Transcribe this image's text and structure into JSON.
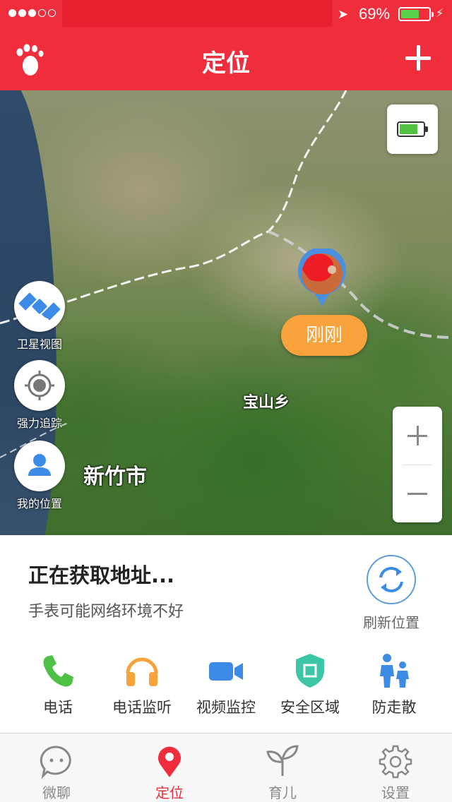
{
  "status_bar": {
    "battery_percent": "69%"
  },
  "nav": {
    "title": "定位"
  },
  "map": {
    "place_labels": {
      "town": "宝山乡",
      "city": "新竹市"
    },
    "side_buttons": [
      {
        "label": "卫星视图",
        "icon": "satellite-icon"
      },
      {
        "label": "强力追踪",
        "icon": "target-icon"
      },
      {
        "label": "我的位置",
        "icon": "person-icon"
      }
    ],
    "marker_time": "刚刚"
  },
  "location": {
    "address": "正在获取地址...",
    "note": "手表可能网络环境不好",
    "refresh_label": "刷新位置"
  },
  "functions": [
    {
      "label": "电话",
      "icon": "phone-icon",
      "color": "#4cc146"
    },
    {
      "label": "电话监听",
      "icon": "headphones-icon",
      "color": "#f7a23a"
    },
    {
      "label": "视频监控",
      "icon": "video-camera-icon",
      "color": "#3c8ce7"
    },
    {
      "label": "安全区域",
      "icon": "shield-icon",
      "color": "#3cc6a6"
    },
    {
      "label": "防走散",
      "icon": "family-icon",
      "color": "#3c8ce7"
    }
  ],
  "tabs": [
    {
      "label": "微聊",
      "icon": "chat-icon",
      "active": false
    },
    {
      "label": "定位",
      "icon": "location-pin-icon",
      "active": true
    },
    {
      "label": "育儿",
      "icon": "sprout-icon",
      "active": false
    },
    {
      "label": "设置",
      "icon": "gear-icon",
      "active": false
    }
  ],
  "colors": {
    "brand_red": "#f02d3c",
    "accent_blue": "#3c8ce7",
    "bubble_orange": "#f7a23a"
  }
}
